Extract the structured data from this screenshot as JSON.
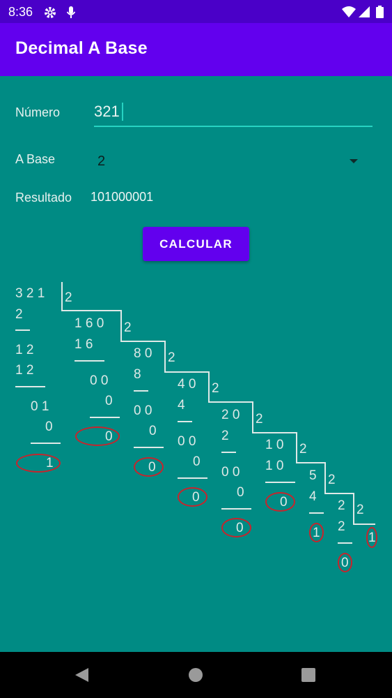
{
  "status_bar": {
    "time": "8:36",
    "icons": [
      "gear-icon",
      "mic-icon",
      "wifi-icon",
      "signal-icon",
      "battery-icon"
    ]
  },
  "app_bar": {
    "title": "Decimal A Base"
  },
  "form": {
    "number_label": "Número",
    "number_value": "321",
    "base_label": "A Base",
    "base_value": "2",
    "result_label": "Resultado",
    "result_value": "101000001",
    "calculate_label": "CALCULAR"
  },
  "division": {
    "steps": [
      {
        "dividend": "3 2 1",
        "divisor": "2",
        "partial": [
          "2",
          "1 2",
          "1 2",
          "0 1",
          "0"
        ],
        "remainder": "1"
      },
      {
        "dividend": "1 6 0",
        "divisor": "2",
        "partial": [
          "1 6",
          "0 0",
          "0"
        ],
        "remainder": "0"
      },
      {
        "dividend": "8 0",
        "divisor": "2",
        "partial": [
          "8",
          "0 0",
          "0"
        ],
        "remainder": "0"
      },
      {
        "dividend": "4 0",
        "divisor": "2",
        "partial": [
          "4",
          "0 0",
          "0"
        ],
        "remainder": "0"
      },
      {
        "dividend": "2 0",
        "divisor": "2",
        "partial": [
          "2",
          "0 0",
          "0"
        ],
        "remainder": "0"
      },
      {
        "dividend": "1 0",
        "divisor": "2",
        "partial": [
          "1 0"
        ],
        "remainder": "0"
      },
      {
        "dividend": "5",
        "divisor": "2",
        "partial": [
          "4"
        ],
        "remainder": "1"
      },
      {
        "dividend": "2",
        "divisor": "2",
        "partial": [
          "2"
        ],
        "remainder": "0"
      }
    ],
    "final_quotient": "1"
  },
  "colors": {
    "app_bar": "#6200ee",
    "status_bar": "#4a00c8",
    "background": "#008b84",
    "accent_underline": "#27d3c2",
    "remainder_circle": "#c8242c"
  },
  "nav_bar": {
    "icons": [
      "back-icon",
      "home-icon",
      "recents-icon"
    ]
  }
}
